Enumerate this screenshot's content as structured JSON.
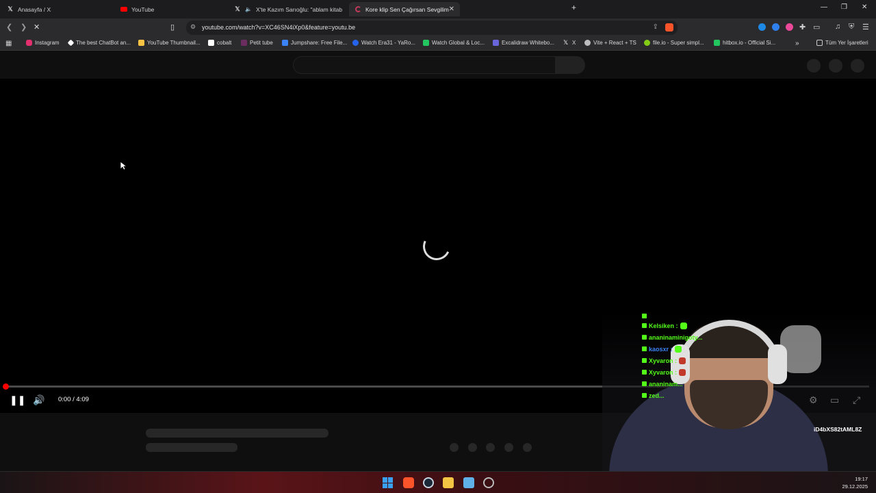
{
  "browser": {
    "tabs": [
      {
        "title": "Anasayfa / X",
        "icon": "x-logo-icon",
        "active": false
      },
      {
        "title": "YouTube",
        "icon": "youtube-icon",
        "active": false
      },
      {
        "title": "X'te Kazım Sarıoğlu: \"ablam kitab",
        "icon": "x-logo-icon",
        "active": false
      },
      {
        "title": "Kore klip Sen Çağırsan Sevgilim",
        "icon": "loading-icon",
        "active": true
      }
    ],
    "url": "youtube.com/watch?v=XC46SN4iXp0&feature=youtu.be",
    "bookmarks": [
      {
        "label": "Instagram",
        "color": "#e1306c"
      },
      {
        "label": "The best ChatBot an...",
        "color": "#ffffff"
      },
      {
        "label": "YouTube Thumbnail...",
        "color": "#f6c344"
      },
      {
        "label": "cobalt",
        "color": "#ffffff"
      },
      {
        "label": "Petit tube",
        "color": "#6b2c5f"
      },
      {
        "label": "Jumpshare: Free File...",
        "color": "#3b82f6"
      },
      {
        "label": "Watch Era31 - YaRo...",
        "color": "#2563eb"
      },
      {
        "label": "Watch Global & Loc...",
        "color": "#22c55e"
      },
      {
        "label": "Excalidraw Whitebo...",
        "color": "#6965db"
      },
      {
        "label": "X",
        "color": "#ffffff"
      },
      {
        "label": "Vite + React + TS",
        "color": "#bdbdbd"
      },
      {
        "label": "file.io - Super simpl...",
        "color": "#84cc16"
      },
      {
        "label": "hitbox.io - Official Si...",
        "color": "#22c55e"
      }
    ],
    "all_bookmarks_label": "Tüm Yer İşaretleri"
  },
  "player": {
    "time": "0:00 / 4:09",
    "progress_fraction": 0.0
  },
  "chat": [
    {
      "user": "Kelsiken :",
      "color": "#53fc18"
    },
    {
      "user": "ananinaminigoty...",
      "color": "#53fc18"
    },
    {
      "user": "kaosxr :",
      "color": "#3b82f6"
    },
    {
      "user": "Xyvaron :",
      "color": "#53fc18"
    },
    {
      "user": "Xyvaron :",
      "color": "#53fc18"
    },
    {
      "user": "ananinam...",
      "color": "#53fc18"
    },
    {
      "user": "zed...",
      "color": "#53fc18"
    }
  ],
  "stream_watermark": "iD4bXS82tAML8Z",
  "taskbar": {
    "time": "19:17",
    "date": "29.12.2025"
  }
}
